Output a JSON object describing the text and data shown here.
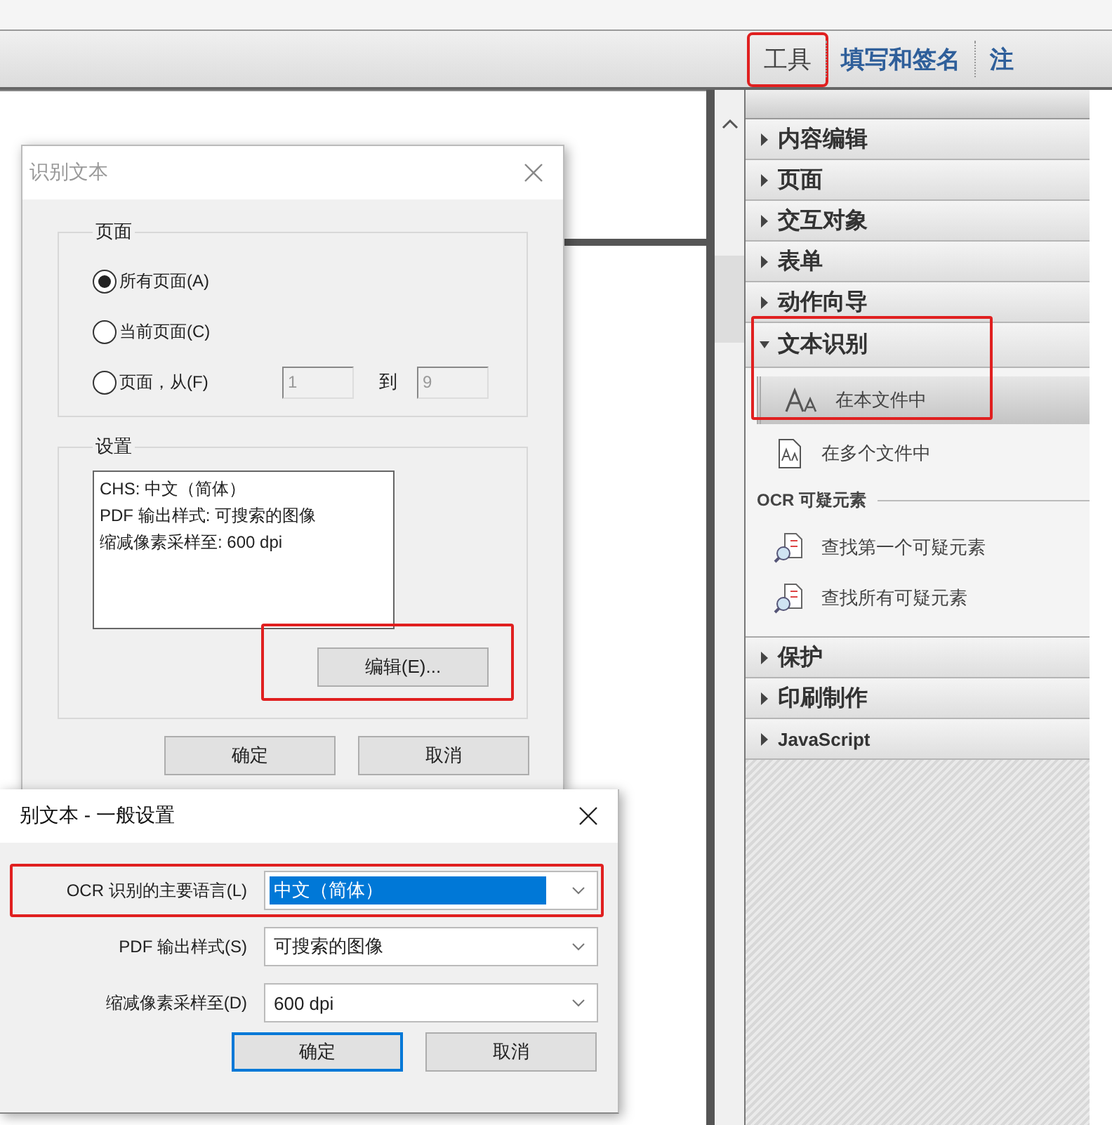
{
  "top_tabs": [
    {
      "label": "工具",
      "selected": true,
      "highlighted": true
    },
    {
      "label": "填写和签名",
      "selected": false,
      "highlighted": false
    },
    {
      "label": "注",
      "selected": false,
      "highlighted": false
    }
  ],
  "panel": {
    "sections": [
      {
        "label": "内容编辑",
        "expanded": false,
        "highlighted": false
      },
      {
        "label": "页面",
        "expanded": false,
        "highlighted": false
      },
      {
        "label": "交互对象",
        "expanded": false,
        "highlighted": false
      },
      {
        "label": "表单",
        "expanded": false,
        "highlighted": false
      },
      {
        "label": "动作向导",
        "expanded": false,
        "highlighted": false
      },
      {
        "label": "文本识别",
        "expanded": true,
        "highlighted": true,
        "children": [
          {
            "kind": "command",
            "label": "在本文件中",
            "selected": true
          },
          {
            "kind": "command",
            "label": "在多个文件中",
            "selected": false
          },
          {
            "kind": "heading",
            "label": "OCR 可疑元素"
          },
          {
            "kind": "command",
            "label": "查找第一个可疑元素",
            "selected": false
          },
          {
            "kind": "command",
            "label": "查找所有可疑元素",
            "selected": false
          }
        ]
      },
      {
        "label": "保护",
        "expanded": false,
        "highlighted": false
      },
      {
        "label": "印刷制作",
        "expanded": false,
        "highlighted": false
      },
      {
        "label": "JavaScript",
        "expanded": false,
        "highlighted": false
      }
    ]
  },
  "recognize_dialog": {
    "title": "识别文本",
    "pages_group": {
      "legend": "页面",
      "options": [
        {
          "label": "所有页面(A)",
          "selected": true
        },
        {
          "label": "当前页面(C)",
          "selected": false
        },
        {
          "label": "页面，从(F)",
          "selected": false
        }
      ],
      "range_from": "1",
      "range_to_label": "到",
      "range_to": "9",
      "range_disabled": true
    },
    "settings_group": {
      "legend": "设置",
      "summary": [
        "CHS: 中文（简体）",
        "PDF 输出样式: 可搜索的图像",
        "缩减像素采样至: 600 dpi"
      ],
      "edit_button": {
        "label": "编辑(E)...",
        "highlighted": true
      }
    },
    "buttons": [
      {
        "label": "确定",
        "default": false
      },
      {
        "label": "取消",
        "default": false
      }
    ]
  },
  "settings_dialog": {
    "title": "别文本 - 一般设置",
    "fields": [
      {
        "label": "OCR 识别的主要语言(L)",
        "value": "中文（简体）",
        "selected": true,
        "highlighted": true
      },
      {
        "label": "PDF 输出样式(S)",
        "value": "可搜索的图像",
        "selected": false,
        "highlighted": false
      },
      {
        "label": "缩减像素采样至(D)",
        "value": "600 dpi",
        "selected": false,
        "highlighted": false
      }
    ],
    "buttons": [
      {
        "label": "确定",
        "default": true
      },
      {
        "label": "取消",
        "default": false
      }
    ]
  }
}
